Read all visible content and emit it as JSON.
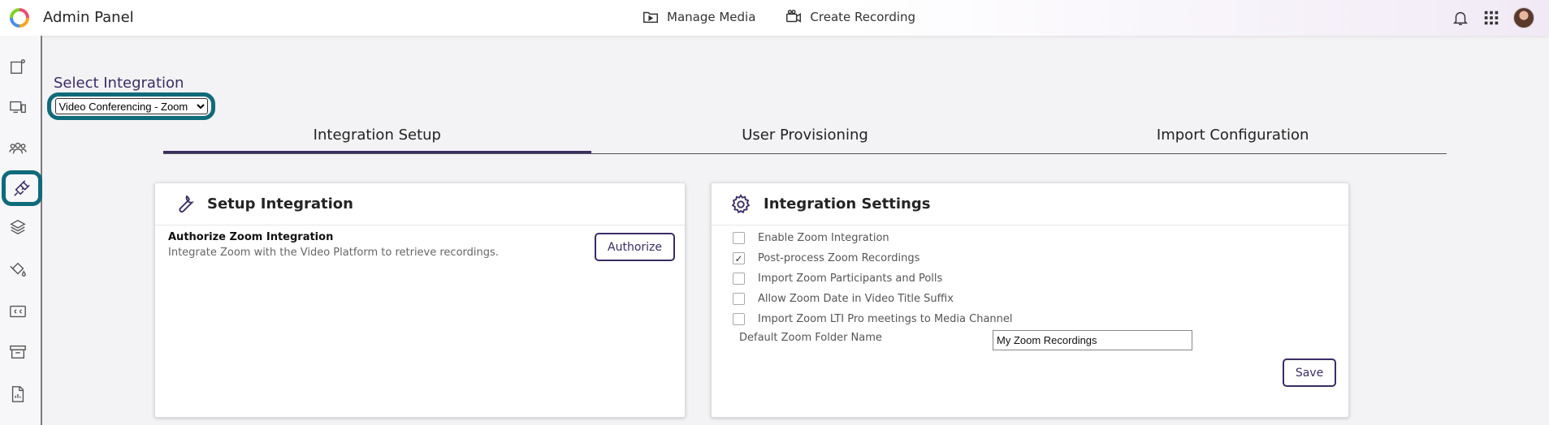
{
  "app": {
    "title": "Admin Panel"
  },
  "topnav": [
    {
      "label": "Manage Media",
      "icon": "play-folder-icon"
    },
    {
      "label": "Create Recording",
      "icon": "camera-icon"
    }
  ],
  "topright_icons": [
    "bell-icon",
    "apps-grid-icon",
    "user-avatar"
  ],
  "sidebar": {
    "items": [
      {
        "icon": "new-item-icon"
      },
      {
        "icon": "devices-icon"
      },
      {
        "icon": "users-icon"
      },
      {
        "icon": "plug-icon",
        "active": true
      },
      {
        "icon": "layers-icon"
      },
      {
        "icon": "paint-bucket-icon"
      },
      {
        "icon": "closed-caption-icon"
      },
      {
        "icon": "archive-icon"
      },
      {
        "icon": "file-report-icon"
      }
    ]
  },
  "integration": {
    "label": "Select Integration",
    "selected": "Video Conferencing - Zoom"
  },
  "tabs": [
    {
      "label": "Integration Setup",
      "active": true
    },
    {
      "label": "User Provisioning"
    },
    {
      "label": "Import Configuration"
    }
  ],
  "setup": {
    "title": "Setup Integration",
    "auth_title": "Authorize Zoom Integration",
    "auth_desc": "Integrate Zoom with the Video Platform to retrieve recordings.",
    "auth_button": "Authorize"
  },
  "settings": {
    "title": "Integration Settings",
    "options": [
      {
        "label": "Enable Zoom Integration",
        "checked": false
      },
      {
        "label": "Post-process Zoom Recordings",
        "checked": true
      },
      {
        "label": "Import Zoom Participants and Polls",
        "checked": false
      },
      {
        "label": "Allow Zoom Date in Video Title Suffix",
        "checked": false
      },
      {
        "label": "Import Zoom LTI Pro meetings to Media Channel",
        "checked": false
      }
    ],
    "folder_label": "Default Zoom Folder Name",
    "folder_value": "My Zoom Recordings",
    "save_button": "Save"
  },
  "colors": {
    "accent": "#3a2c63",
    "highlight": "#0f6b7a"
  }
}
